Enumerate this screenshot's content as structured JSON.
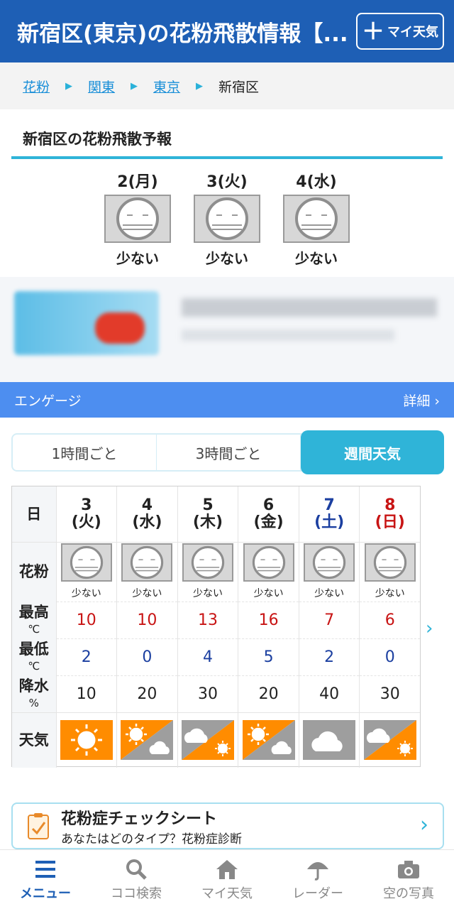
{
  "header": {
    "title": "新宿区(東京)の花粉飛散情報【...",
    "my_weather_label": "マイ天気",
    "plus": "＋"
  },
  "breadcrumb": {
    "items": [
      "花粉",
      "関東",
      "東京"
    ],
    "current": "新宿区"
  },
  "forecast": {
    "heading": "新宿区の花粉飛散予報",
    "days": [
      {
        "label": "2(月)",
        "level": "少ない"
      },
      {
        "label": "3(火)",
        "level": "少ない"
      },
      {
        "label": "4(水)",
        "level": "少ない"
      }
    ]
  },
  "ad_bar": {
    "label": "エンゲージ",
    "detail": "詳細 ›"
  },
  "tabs": [
    "1時間ごと",
    "3時間ごと",
    "週間天気"
  ],
  "weekly": {
    "labels": {
      "day": "日",
      "pollen": "花粉",
      "high": "最高",
      "high_unit": "℃",
      "low": "最低",
      "low_unit": "℃",
      "precip": "降水",
      "precip_unit": "%",
      "weather": "天気"
    },
    "days": [
      {
        "num": "3",
        "dow": "(火)",
        "kind": "weekday",
        "pollen": "少ない",
        "high": "10",
        "low": "2",
        "precip": "10",
        "weather": "sunny-icon"
      },
      {
        "num": "4",
        "dow": "(水)",
        "kind": "weekday",
        "pollen": "少ない",
        "high": "10",
        "low": "0",
        "precip": "20",
        "weather": "sunny-then-cloudy-icon"
      },
      {
        "num": "5",
        "dow": "(木)",
        "kind": "weekday",
        "pollen": "少ない",
        "high": "13",
        "low": "4",
        "precip": "30",
        "weather": "cloudy-then-sunny-icon"
      },
      {
        "num": "6",
        "dow": "(金)",
        "kind": "weekday",
        "pollen": "少ない",
        "high": "16",
        "low": "5",
        "precip": "20",
        "weather": "sunny-then-cloudy-icon"
      },
      {
        "num": "7",
        "dow": "(土)",
        "kind": "saturday",
        "pollen": "少ない",
        "high": "7",
        "low": "2",
        "precip": "40",
        "weather": "cloudy-icon"
      },
      {
        "num": "8",
        "dow": "(日)",
        "kind": "sunday",
        "pollen": "少ない",
        "high": "6",
        "low": "0",
        "precip": "30",
        "weather": "cloudy-then-sunny-icon"
      }
    ]
  },
  "check_sheet": {
    "title": "花粉症チェックシート",
    "subtitle": "あなたはどのタイプ？花粉症診断"
  },
  "bottom_nav": [
    {
      "label": "メニュー",
      "icon": "menu-icon",
      "active": true
    },
    {
      "label": "ココ検索",
      "icon": "search-icon"
    },
    {
      "label": "マイ天気",
      "icon": "home-icon"
    },
    {
      "label": "レーダー",
      "icon": "umbrella-icon"
    },
    {
      "label": "空の写真",
      "icon": "camera-icon"
    }
  ],
  "colors": {
    "header_bg": "#1e5fb5",
    "accent": "#2fb4d8",
    "high": "#c81414",
    "low": "#1b3fa0",
    "sunny": "#ff8c00",
    "cloudy": "#9e9e9e"
  }
}
